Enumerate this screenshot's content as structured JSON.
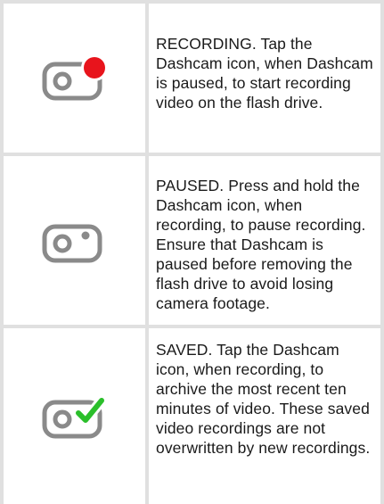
{
  "rows": [
    {
      "icon": "dashcam-recording-icon",
      "status": "RECORDING",
      "description": ". Tap the Dashcam icon, when Dashcam is paused, to start recording video on the flash drive."
    },
    {
      "icon": "dashcam-paused-icon",
      "status": "PAUSED",
      "description": ". Press and hold the Dashcam icon, when recording, to pause recording. Ensure that Dashcam is paused before removing the flash drive to avoid losing camera footage."
    },
    {
      "icon": "dashcam-saved-icon",
      "status": "SAVED",
      "description": ". Tap the Dashcam icon, when recording, to archive the most recent ten minutes of video. These saved video recordings are not overwritten by new recordings."
    }
  ],
  "colors": {
    "grid": "#e0e0e0",
    "icon_gray": "#8a8a8a",
    "recording_red": "#e8141c",
    "saved_green": "#2bbf2b",
    "text": "#1a1a1a"
  }
}
